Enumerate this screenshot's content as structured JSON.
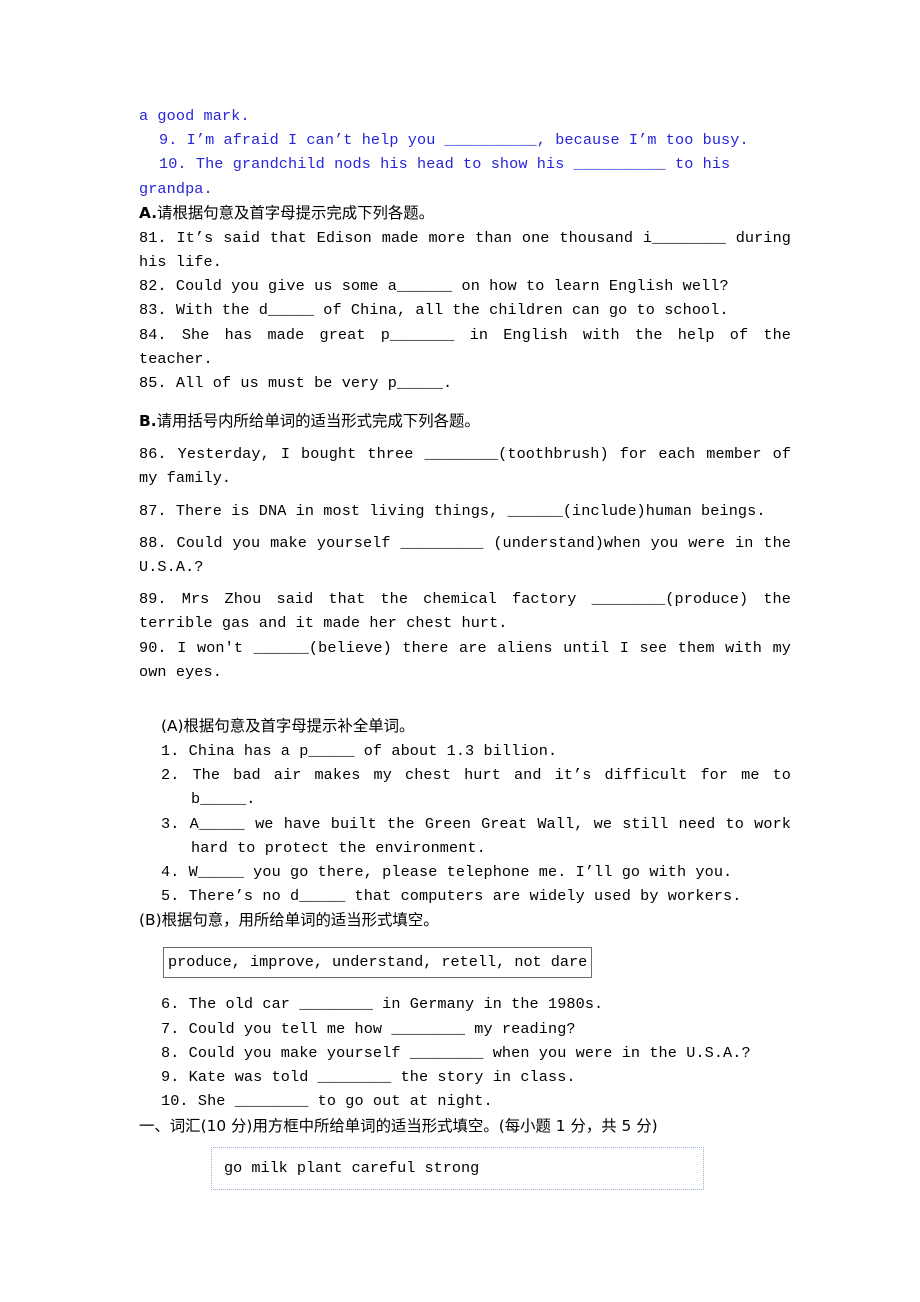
{
  "document": {
    "type": "english-exam-worksheet",
    "colors": {
      "body_text": "#000000",
      "highlight_text": "#2626d8",
      "box_border": "#6e6e6e",
      "light_box_border": "#9bb4d6"
    }
  },
  "carryover": {
    "tail_line": "a good mark.",
    "item9": "9. I’m afraid I can’t help you __________, because I’m too busy.",
    "item10": "10. The grandchild nods his head to show his __________ to his",
    "item10_tail": "grandpa."
  },
  "section_a": {
    "heading_label": "A.",
    "heading_text": "请根据句意及首字母提示完成下列各题。",
    "items": [
      "81. It’s said that Edison made more than one thousand i________ during his life.",
      "82. Could you give us some a______ on how to learn English well?",
      "83. With the d_____ of China, all the children can go to school.",
      "84. She has made great p_______ in English with the help of the teacher.",
      "85. All of us must be very p_____."
    ]
  },
  "section_b": {
    "heading_label": "B.",
    "heading_text": "请用括号内所给单词的适当形式完成下列各题。",
    "items": [
      "86. Yesterday, I bought three ________(toothbrush) for each member of my family.",
      "87. There is DNA in most living things, ______(include)human beings.",
      "88. Could you make yourself _________ (understand)when you were in the U.S.A.?",
      "89. Mrs Zhou said that the chemical factory ________(produce) the terrible gas and it made her chest hurt.",
      "90. I won't ______(believe) there are aliens until I see them with my own eyes."
    ]
  },
  "section_capital_a": {
    "heading": "(A)根据句意及首字母提示补全单词。",
    "items": [
      "1. China has a p_____ of about 1.3 billion.",
      "2. The bad air makes my chest hurt and it’s difficult for me to b_____.",
      "3. A_____ we have built the Green Great Wall, we still need to work hard to protect the environment.",
      "4. W_____ you go there, please telephone me. I’ll go with you.",
      "5. There’s no d_____ that computers are widely used by workers."
    ]
  },
  "section_capital_b": {
    "heading": "(B)根据句意，用所给单词的适当形式填空。",
    "word_bank": "produce, improve, understand, retell, not dare",
    "items": [
      "6. The old car ________ in Germany in the 1980s.",
      "7. Could you tell me how ________ my reading?",
      "8. Could you make yourself ________ when you were in the U.S.A.?",
      "9. Kate was told ________ the story in class.",
      "10. She ________ to go out at night."
    ]
  },
  "section_one": {
    "heading": "一、词汇(10 分)用方框中所给单词的适当形式填空。(每小题 1 分，共 5 分)",
    "word_bank": "go milk plant careful strong"
  }
}
